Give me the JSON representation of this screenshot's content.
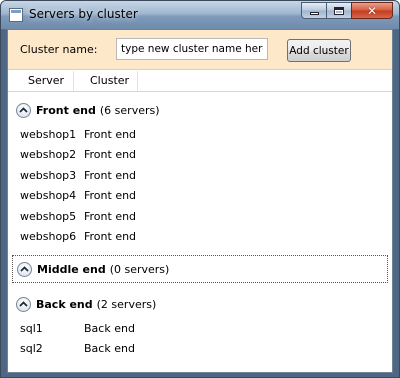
{
  "window": {
    "title": "Servers by cluster",
    "icon": "window-app-icon",
    "controls": {
      "minimize": "minimize-icon",
      "maximize": "maximize-icon",
      "close": "close-icon"
    }
  },
  "toolbar": {
    "cluster_label": "Cluster name:",
    "input_value": "type new cluster name here",
    "add_button": "Add cluster",
    "background": "#fde9c9"
  },
  "columns": [
    "Server",
    "Cluster"
  ],
  "groups": [
    {
      "name": "Front end",
      "count": "(6 servers)",
      "expanded": true,
      "rows": [
        {
          "server": "webshop1",
          "cluster": "Front end"
        },
        {
          "server": "webshop2",
          "cluster": "Front end"
        },
        {
          "server": "webshop3",
          "cluster": "Front end"
        },
        {
          "server": "webshop4",
          "cluster": "Front end"
        },
        {
          "server": "webshop5",
          "cluster": "Front end"
        },
        {
          "server": "webshop6",
          "cluster": "Front end"
        }
      ]
    },
    {
      "name": "Middle end",
      "count": "(0 servers)",
      "expanded": true,
      "focused": true,
      "rows": []
    },
    {
      "name": "Back end",
      "count": "(2 servers)",
      "expanded": true,
      "rows": [
        {
          "server": "sql1",
          "cluster": "Back end"
        },
        {
          "server": "sql2",
          "cluster": "Back end"
        }
      ]
    }
  ]
}
